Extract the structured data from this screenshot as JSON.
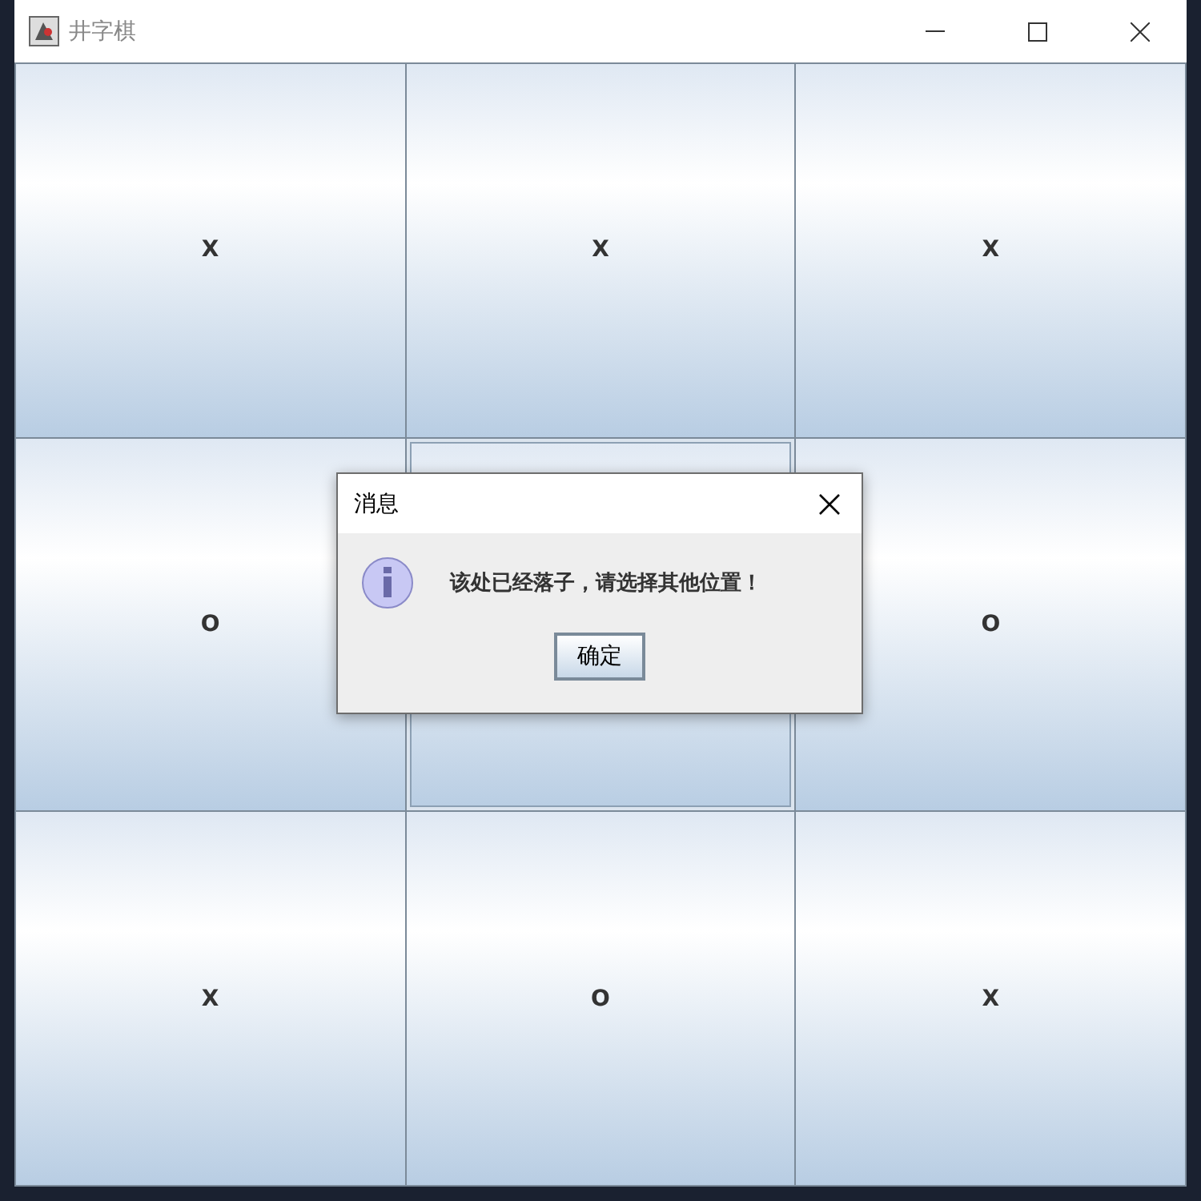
{
  "window": {
    "title": "井字棋"
  },
  "board": [
    {
      "mark": "X",
      "focused": false
    },
    {
      "mark": "X",
      "focused": false
    },
    {
      "mark": "X",
      "focused": false
    },
    {
      "mark": "O",
      "focused": false
    },
    {
      "focused": true
    },
    {
      "mark": "O",
      "focused": false
    },
    {
      "mark": "X",
      "focused": false
    },
    {
      "mark": "O",
      "focused": false
    },
    {
      "mark": "X",
      "focused": false
    }
  ],
  "dialog": {
    "title": "消息",
    "message": "该处已经落子，请选择其他位置！",
    "button": "确定"
  }
}
